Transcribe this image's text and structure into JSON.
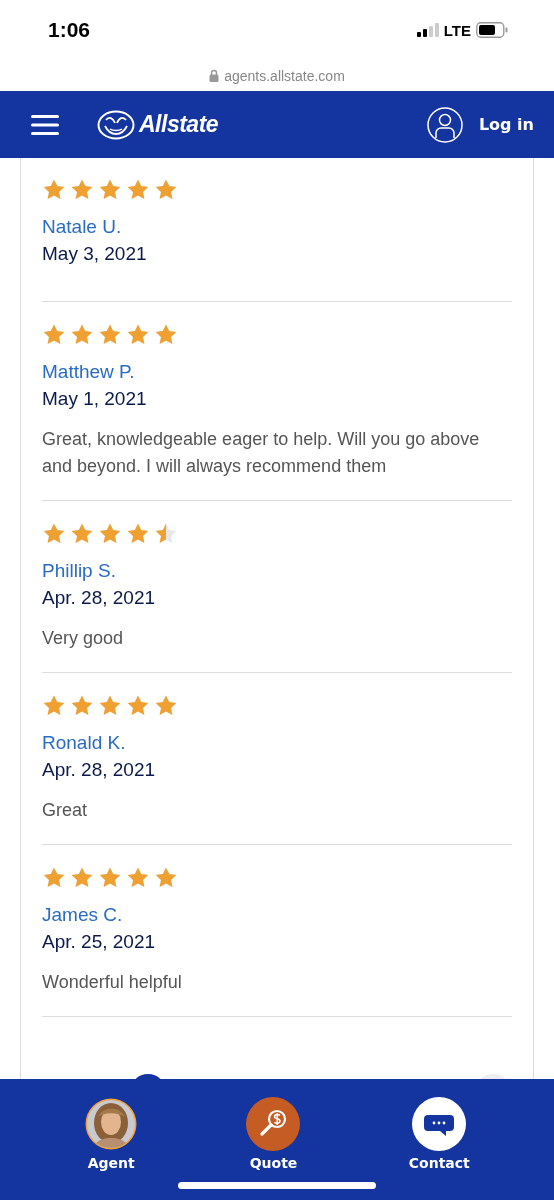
{
  "status_bar": {
    "time": "1:06",
    "network": "LTE"
  },
  "address_bar": {
    "url": "agents.allstate.com"
  },
  "header": {
    "brand": "Allstate",
    "login": "Log in"
  },
  "reviews": [
    {
      "stars": 5,
      "name": "Natale U.",
      "date": "May 3, 2021"
    },
    {
      "stars": 5,
      "name": "Matthew P.",
      "date": "May 1, 2021",
      "comment": "Great, knowledgeable eager to help. Will you go above and beyond. I will always recommend them"
    },
    {
      "stars": 4.5,
      "name": "Phillip S.",
      "date": "Apr. 28, 2021",
      "comment": "Very good"
    },
    {
      "stars": 5,
      "name": "Ronald K.",
      "date": "Apr. 28, 2021",
      "comment": "Great"
    },
    {
      "stars": 5,
      "name": "James C.",
      "date": "Apr. 25, 2021",
      "comment": "Wonderful helpful"
    }
  ],
  "bottom_nav": [
    {
      "kind": "agent",
      "label": "Agent"
    },
    {
      "kind": "quote",
      "label": "Quote"
    },
    {
      "kind": "contact",
      "label": "Contact"
    }
  ]
}
